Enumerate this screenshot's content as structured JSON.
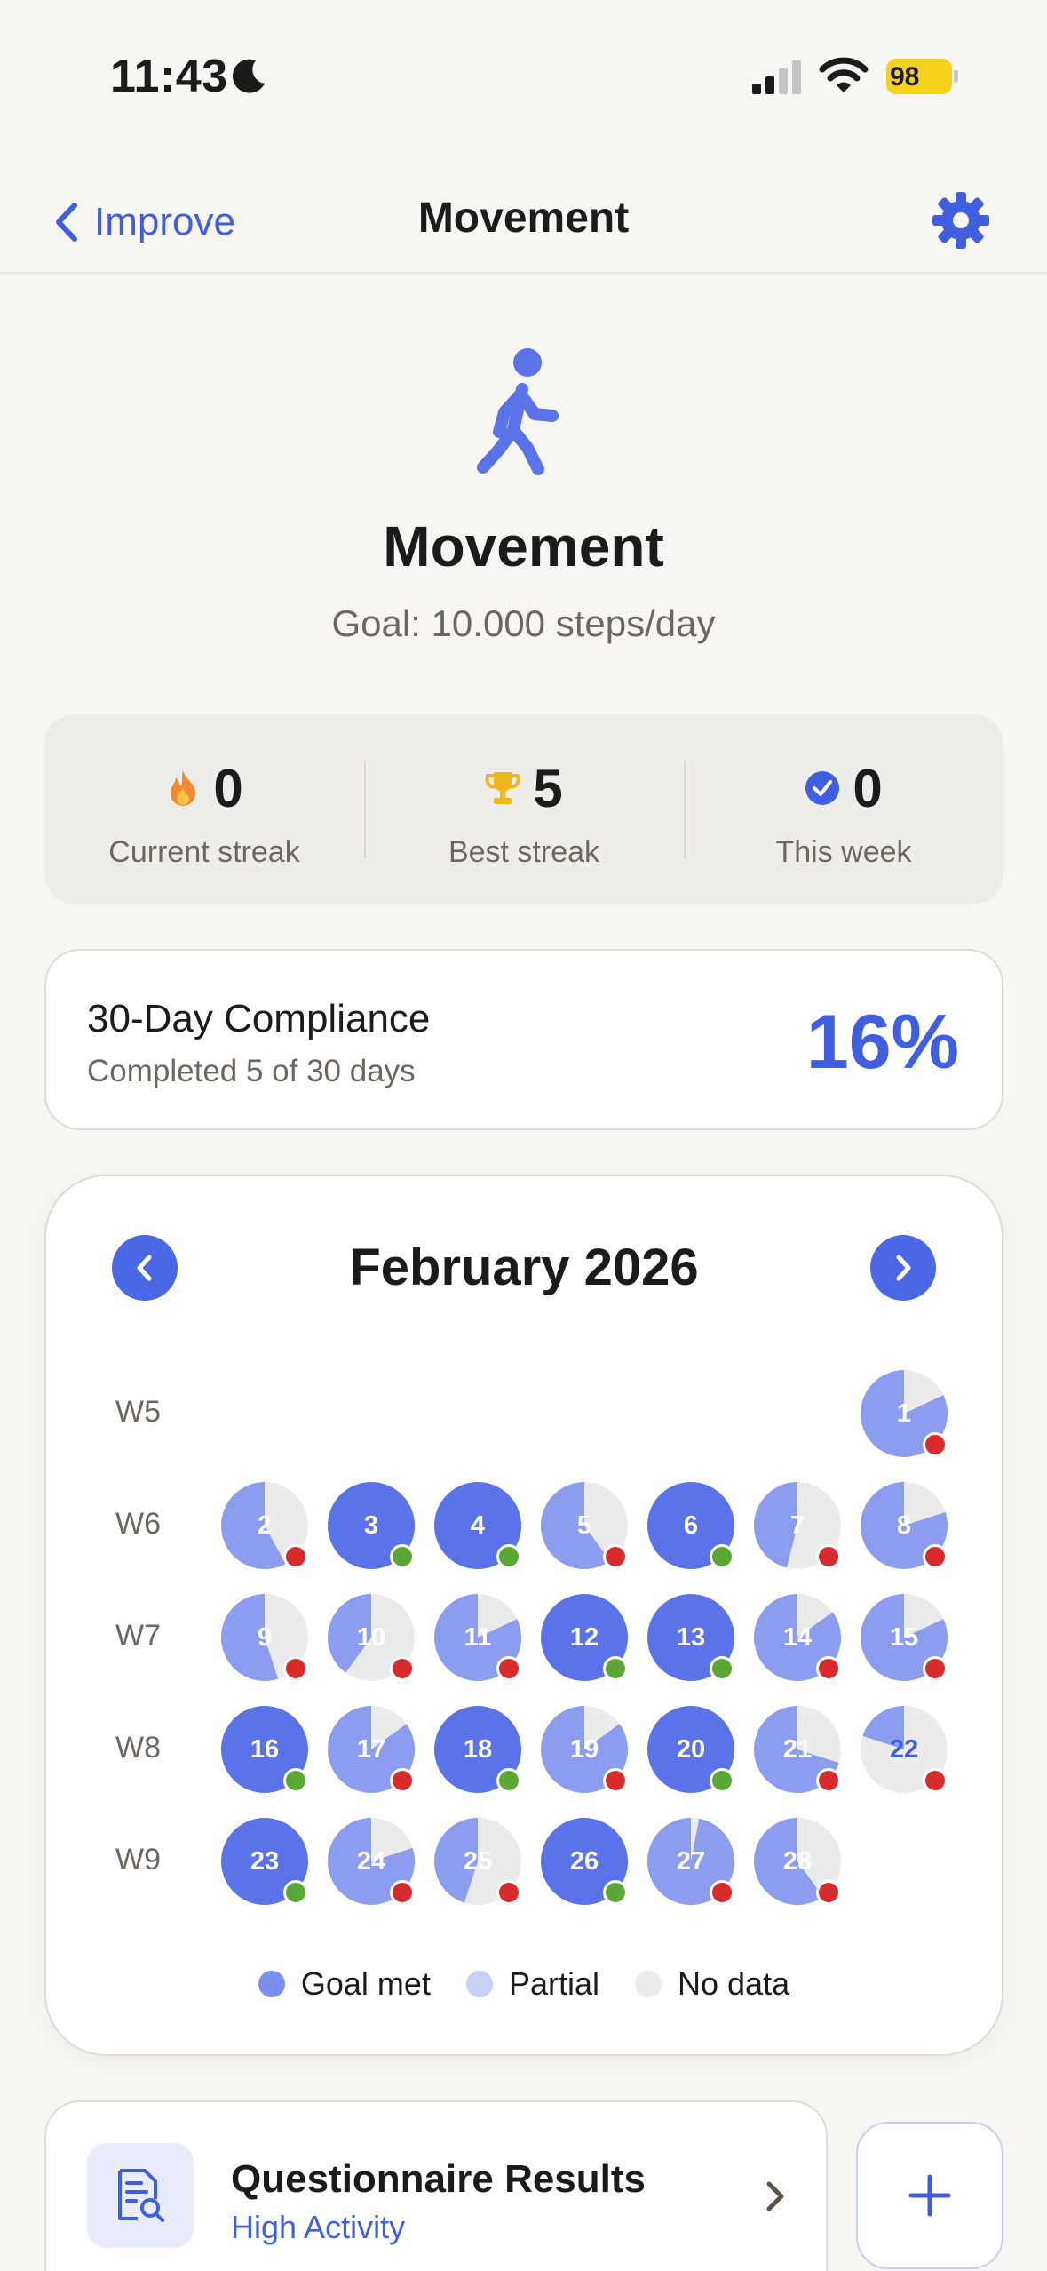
{
  "status_bar": {
    "time": "11:43",
    "battery": "98"
  },
  "nav": {
    "back_label": "Improve",
    "title": "Movement"
  },
  "hero": {
    "title": "Movement",
    "goal": "Goal: 10.000 steps/day"
  },
  "stats": [
    {
      "icon": "flame-icon",
      "value": "0",
      "label": "Current streak"
    },
    {
      "icon": "trophy-icon",
      "value": "5",
      "label": "Best streak"
    },
    {
      "icon": "check-circle-icon",
      "value": "0",
      "label": "This week"
    }
  ],
  "compliance": {
    "title": "30-Day Compliance",
    "subtitle": "Completed 5 of 30 days",
    "percent": "16%"
  },
  "calendar": {
    "title": "February 2026",
    "weeks": [
      {
        "label": "W5",
        "days": [
          {
            "day": "1",
            "col": 6,
            "fraction": 0.82,
            "status": "partial"
          }
        ]
      },
      {
        "label": "W6",
        "days": [
          {
            "day": "2",
            "col": 0,
            "fraction": 0.58,
            "status": "partial"
          },
          {
            "day": "3",
            "col": 1,
            "fraction": 1.0,
            "status": "met"
          },
          {
            "day": "4",
            "col": 2,
            "fraction": 1.0,
            "status": "met"
          },
          {
            "day": "5",
            "col": 3,
            "fraction": 0.6,
            "status": "partial"
          },
          {
            "day": "6",
            "col": 4,
            "fraction": 1.0,
            "status": "met"
          },
          {
            "day": "7",
            "col": 5,
            "fraction": 0.46,
            "status": "partial"
          },
          {
            "day": "8",
            "col": 6,
            "fraction": 0.8,
            "status": "partial"
          }
        ]
      },
      {
        "label": "W7",
        "days": [
          {
            "day": "9",
            "col": 0,
            "fraction": 0.55,
            "status": "partial"
          },
          {
            "day": "10",
            "col": 1,
            "fraction": 0.4,
            "status": "partial"
          },
          {
            "day": "11",
            "col": 2,
            "fraction": 0.82,
            "status": "partial"
          },
          {
            "day": "12",
            "col": 3,
            "fraction": 1.0,
            "status": "met"
          },
          {
            "day": "13",
            "col": 4,
            "fraction": 1.0,
            "status": "met"
          },
          {
            "day": "14",
            "col": 5,
            "fraction": 0.85,
            "status": "partial"
          },
          {
            "day": "15",
            "col": 6,
            "fraction": 0.82,
            "status": "partial"
          }
        ]
      },
      {
        "label": "W8",
        "days": [
          {
            "day": "16",
            "col": 0,
            "fraction": 1.0,
            "status": "met"
          },
          {
            "day": "17",
            "col": 1,
            "fraction": 0.85,
            "status": "partial"
          },
          {
            "day": "18",
            "col": 2,
            "fraction": 1.0,
            "status": "met"
          },
          {
            "day": "19",
            "col": 3,
            "fraction": 0.85,
            "status": "partial"
          },
          {
            "day": "20",
            "col": 4,
            "fraction": 1.0,
            "status": "met"
          },
          {
            "day": "21",
            "col": 5,
            "fraction": 0.7,
            "status": "partial"
          },
          {
            "day": "22",
            "col": 6,
            "fraction": 0.2,
            "status": "partial"
          }
        ]
      },
      {
        "label": "W9",
        "days": [
          {
            "day": "23",
            "col": 0,
            "fraction": 1.0,
            "status": "met"
          },
          {
            "day": "24",
            "col": 1,
            "fraction": 0.8,
            "status": "partial"
          },
          {
            "day": "25",
            "col": 2,
            "fraction": 0.45,
            "status": "partial"
          },
          {
            "day": "26",
            "col": 3,
            "fraction": 1.0,
            "status": "met"
          },
          {
            "day": "27",
            "col": 4,
            "fraction": 0.97,
            "status": "partial"
          },
          {
            "day": "28",
            "col": 5,
            "fraction": 0.6,
            "status": "partial"
          }
        ]
      }
    ],
    "legend": [
      {
        "label": "Goal met",
        "color": "#7b8ff0"
      },
      {
        "label": "Partial",
        "color": "#c9d0f7"
      },
      {
        "label": "No data",
        "color": "#ebebeb"
      }
    ]
  },
  "questionnaire": {
    "title": "Questionnaire Results",
    "subtitle": "High Activity"
  },
  "colors": {
    "accent": "#3f5fe0",
    "goal_met_fill": "#5b73e8",
    "partial_fill": "#8c9df0",
    "empty_fill": "#ebebeb",
    "status_met": "#5aa736",
    "status_missed": "#d92b2b"
  }
}
